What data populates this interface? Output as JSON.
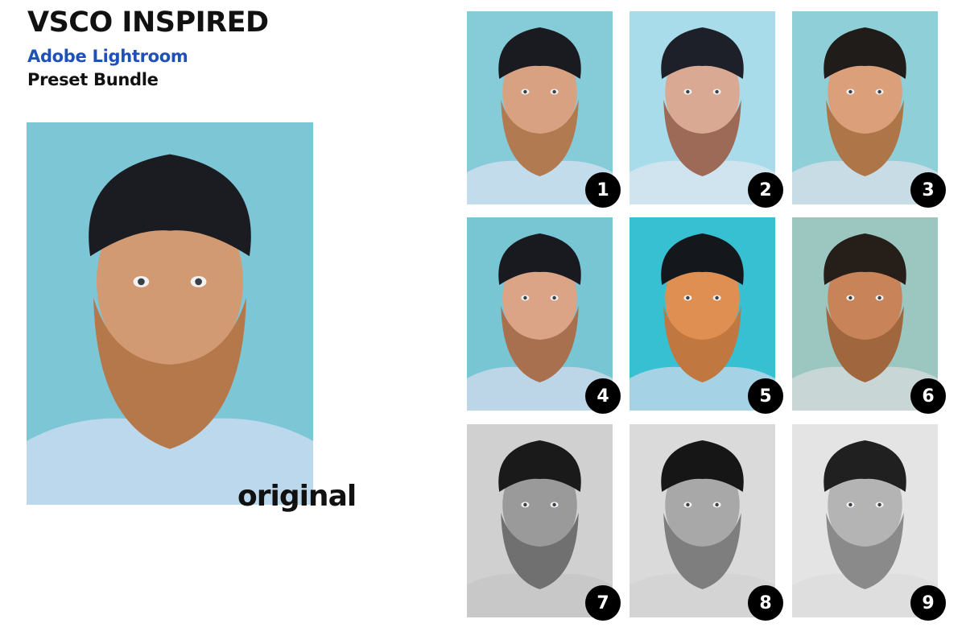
{
  "header": {
    "title": "VSCO INSPIRED",
    "subtitle": "Adobe Lightroom",
    "subtitle2": "Preset Bundle"
  },
  "original": {
    "label": "original",
    "colors": {
      "bg": "#7cc6d6",
      "skin": "#d29a72",
      "beard": "#b5784a",
      "hat": "#1a1c22",
      "shirt": "#bcd8ec"
    }
  },
  "presets": [
    {
      "number": "1",
      "bg": "#86cbd8",
      "skin": "#d8a282",
      "beard": "#b27a50",
      "hat": "#1a1b20",
      "shirt": "#c2dcec"
    },
    {
      "number": "2",
      "bg": "#a9dcea",
      "skin": "#d9a994",
      "beard": "#9e6a58",
      "hat": "#1d2028",
      "shirt": "#d0e4f0"
    },
    {
      "number": "3",
      "bg": "#8fd0d8",
      "skin": "#dba07a",
      "beard": "#ae7548",
      "hat": "#201c1a",
      "shirt": "#c8dce6"
    },
    {
      "number": "4",
      "bg": "#78c6d4",
      "skin": "#dba487",
      "beard": "#a8704e",
      "hat": "#181a20",
      "shirt": "#bcd6e8"
    },
    {
      "number": "5",
      "bg": "#36c0d2",
      "skin": "#e08f52",
      "beard": "#c07840",
      "hat": "#14181c",
      "shirt": "#a6d2e6"
    },
    {
      "number": "6",
      "bg": "#9cc7c0",
      "skin": "#c88458",
      "beard": "#a0663e",
      "hat": "#261e18",
      "shirt": "#c8d6d6"
    },
    {
      "number": "7",
      "bg": "#d0d0d0",
      "skin": "#9a9a9a",
      "beard": "#707070",
      "hat": "#1a1a1a",
      "shirt": "#c8c8c8"
    },
    {
      "number": "8",
      "bg": "#dadada",
      "skin": "#a8a8a8",
      "beard": "#7e7e7e",
      "hat": "#161616",
      "shirt": "#d4d4d4"
    },
    {
      "number": "9",
      "bg": "#e4e4e4",
      "skin": "#b4b4b4",
      "beard": "#8a8a8a",
      "hat": "#202020",
      "shirt": "#dedede"
    }
  ]
}
